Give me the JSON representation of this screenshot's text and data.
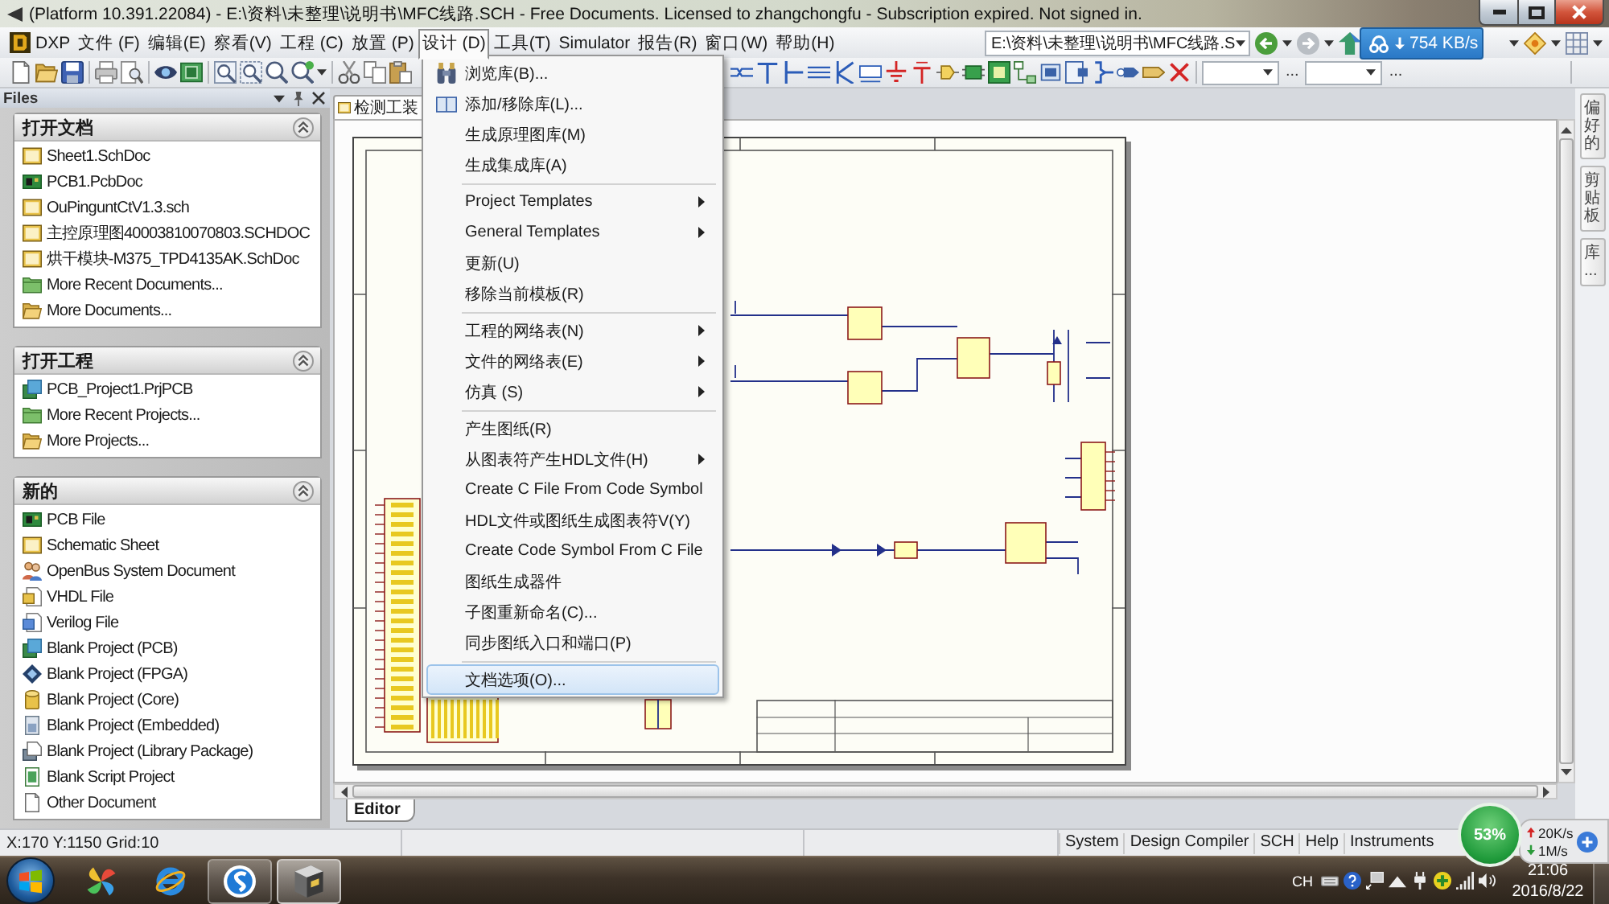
{
  "window": {
    "title": "(Platform 10.391.22084) - E:\\资料\\未整理\\说明书\\MFC线路.SCH - Free Documents. Licensed to zhangchongfu - Subscription expired. Not signed in."
  },
  "menu_bar": {
    "items": [
      {
        "label": "DXP",
        "kind": "logo",
        "selected": false
      },
      {
        "label": "文件 (F)",
        "kind": "menu",
        "selected": false
      },
      {
        "label": "编辑(E)",
        "kind": "menu",
        "selected": false
      },
      {
        "label": "察看(V)",
        "kind": "menu",
        "selected": false
      },
      {
        "label": "工程 (C)",
        "kind": "menu",
        "selected": false
      },
      {
        "label": "放置 (P)",
        "kind": "menu",
        "selected": false
      },
      {
        "label": "设计 (D)",
        "kind": "menu",
        "selected": true
      },
      {
        "label": "工具(T)",
        "kind": "menu",
        "selected": false
      },
      {
        "label": "Simulator",
        "kind": "menu",
        "selected": false
      },
      {
        "label": "报告(R)",
        "kind": "menu",
        "selected": false
      },
      {
        "label": "窗口(W)",
        "kind": "menu",
        "selected": false
      },
      {
        "label": "帮助(H)",
        "kind": "menu",
        "selected": false
      }
    ],
    "path_box": {
      "value": "E:\\资料\\未整理\\说明书\\MFC线路.S"
    }
  },
  "speed_widget": {
    "reading": "754 KB/s"
  },
  "toolbar": {
    "browse_buttons": [
      "...",
      "..."
    ]
  },
  "files_panel": {
    "title": "Files",
    "sections": [
      {
        "title": "打开文档",
        "expanded": true,
        "items": [
          {
            "label": "Sheet1.SchDoc",
            "kind": "schematic"
          },
          {
            "label": "PCB1.PcbDoc",
            "kind": "pcb"
          },
          {
            "label": "OuPinguntCtV1.3.sch",
            "kind": "schematic"
          },
          {
            "label": "主控原理图40003810070803.SCHDOC",
            "kind": "schematic"
          },
          {
            "label": "烘干模块-M375_TPD4135AK.SchDoc",
            "kind": "schematic"
          },
          {
            "label": "More Recent Documents...",
            "kind": "folder"
          },
          {
            "label": "More Documents...",
            "kind": "open_folder"
          }
        ]
      },
      {
        "title": "打开工程",
        "expanded": true,
        "items": [
          {
            "label": "PCB_Project1.PrjPCB",
            "kind": "project"
          },
          {
            "label": "More Recent Projects...",
            "kind": "folder"
          },
          {
            "label": "More Projects...",
            "kind": "open_folder"
          }
        ]
      },
      {
        "title": "新的",
        "expanded": true,
        "items": [
          {
            "label": "PCB File",
            "kind": "pcb"
          },
          {
            "label": "Schematic Sheet",
            "kind": "schematic"
          },
          {
            "label": "OpenBus System Document",
            "kind": "openbus"
          },
          {
            "label": "VHDL File",
            "kind": "vhdl"
          },
          {
            "label": "Verilog File",
            "kind": "verilog"
          },
          {
            "label": "Blank Project (PCB)",
            "kind": "project"
          },
          {
            "label": "Blank Project (FPGA)",
            "kind": "fpga"
          },
          {
            "label": "Blank Project (Core)",
            "kind": "core"
          },
          {
            "label": "Blank Project (Embedded)",
            "kind": "embedded"
          },
          {
            "label": "Blank Project (Library Package)",
            "kind": "library"
          },
          {
            "label": "Blank Script Project",
            "kind": "script"
          },
          {
            "label": "Other Document",
            "kind": "document"
          }
        ]
      }
    ]
  },
  "document_tabs": [
    {
      "label": "检测工装",
      "selected": true
    }
  ],
  "design_menu": {
    "groups": [
      {
        "items": [
          {
            "label": "浏览库(B)...",
            "kind": "browse",
            "submenu": false,
            "selected": false
          },
          {
            "label": "添加/移除库(L)...",
            "kind": "library",
            "submenu": false,
            "selected": false
          },
          {
            "label": "生成原理图库(M)",
            "kind": "plain",
            "submenu": false,
            "selected": false
          },
          {
            "label": "生成集成库(A)",
            "kind": "plain",
            "submenu": false,
            "selected": false
          }
        ]
      },
      {
        "items": [
          {
            "label": "Project Templates",
            "kind": "plain",
            "submenu": true,
            "selected": false
          },
          {
            "label": "General Templates",
            "kind": "plain",
            "submenu": true,
            "selected": false
          },
          {
            "label": "更新(U)",
            "kind": "plain",
            "submenu": false,
            "selected": false
          },
          {
            "label": "移除当前模板(R)",
            "kind": "plain",
            "submenu": false,
            "selected": false
          }
        ]
      },
      {
        "items": [
          {
            "label": "工程的网络表(N)",
            "kind": "plain",
            "submenu": true,
            "selected": false
          },
          {
            "label": "文件的网络表(E)",
            "kind": "plain",
            "submenu": true,
            "selected": false
          },
          {
            "label": "仿真 (S)",
            "kind": "plain",
            "submenu": true,
            "selected": false
          }
        ]
      },
      {
        "items": [
          {
            "label": "产生图纸(R)",
            "kind": "plain",
            "submenu": false,
            "selected": false
          },
          {
            "label": "从图表符产生HDL文件(H)",
            "kind": "plain",
            "submenu": true,
            "selected": false
          },
          {
            "label": "Create C File From Code Symbol",
            "kind": "plain",
            "submenu": false,
            "selected": false
          },
          {
            "label": "HDL文件或图纸生成图表符V(Y)",
            "kind": "plain",
            "submenu": false,
            "selected": false
          },
          {
            "label": "Create Code Symbol From C File",
            "kind": "plain",
            "submenu": false,
            "selected": false
          },
          {
            "label": "图纸生成器件",
            "kind": "plain",
            "submenu": false,
            "selected": false
          },
          {
            "label": "子图重新命名(C)...",
            "kind": "plain",
            "submenu": false,
            "selected": false
          },
          {
            "label": "同步图纸入口和端口(P)",
            "kind": "plain",
            "submenu": false,
            "selected": false
          }
        ]
      },
      {
        "items": [
          {
            "label": "文档选项(O)...",
            "kind": "plain",
            "submenu": false,
            "selected": true
          }
        ]
      }
    ]
  },
  "editor_tabs": [
    {
      "label": "Editor",
      "selected": true
    }
  ],
  "side_tabs": [
    {
      "label": "偏好的",
      "selected": false
    },
    {
      "label": "剪贴板",
      "selected": false
    },
    {
      "label": "库...",
      "selected": false
    }
  ],
  "status_bar": {
    "coordinates": "X:170 Y:1150 Grid:10",
    "panel_buttons": [
      "System",
      "Design Compiler",
      "SCH",
      "Help",
      "Instruments"
    ]
  },
  "network_meter": {
    "percent": "53%",
    "upload": "20K/s",
    "download": "1M/s"
  },
  "taskbar": {
    "apps": [
      {
        "kind": "pinwheel",
        "running": false,
        "selected": false
      },
      {
        "kind": "browser",
        "running": false,
        "selected": false
      },
      {
        "kind": "swoosh",
        "running": true,
        "selected": false
      },
      {
        "kind": "box",
        "running": true,
        "selected": true
      }
    ],
    "tray": {
      "language": "CH",
      "time": "21:06",
      "date": "2016/8/22"
    }
  }
}
